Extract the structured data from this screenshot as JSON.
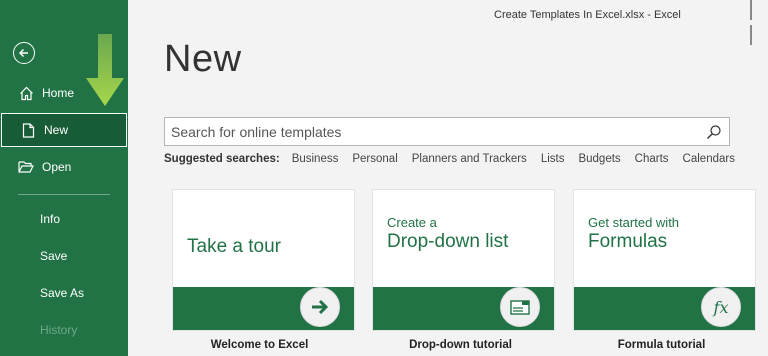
{
  "window": {
    "title": "Create Templates In Excel.xlsx  -  Excel"
  },
  "sidebar": {
    "back_icon": "back-arrow-icon",
    "items": [
      {
        "label": "Home",
        "icon": "home-icon"
      },
      {
        "label": "New",
        "icon": "new-document-icon",
        "selected": true
      },
      {
        "label": "Open",
        "icon": "open-folder-icon"
      },
      {
        "label": "Info"
      },
      {
        "label": "Save"
      },
      {
        "label": "Save As"
      },
      {
        "label": "History",
        "disabled": true
      }
    ]
  },
  "main": {
    "title": "New",
    "search": {
      "placeholder": "Search for online templates"
    },
    "suggested": {
      "label": "Suggested searches:",
      "links": [
        "Business",
        "Personal",
        "Planners and Trackers",
        "Lists",
        "Budgets",
        "Charts",
        "Calendars"
      ]
    },
    "templates": [
      {
        "line1": "",
        "line2": "Take a tour",
        "caption": "Welcome to Excel",
        "icon": "arrow-right-icon"
      },
      {
        "line1": "Create a",
        "line2": "Drop-down list",
        "caption": "Drop-down tutorial",
        "icon": "dropdown-list-icon"
      },
      {
        "line1": "Get started with",
        "line2": "Formulas",
        "caption": "Formula tutorial",
        "icon": "function-fx-icon"
      }
    ]
  },
  "colors": {
    "accent": "#217346",
    "accent_dark": "#185c37",
    "arrow": "#8cc63f"
  }
}
